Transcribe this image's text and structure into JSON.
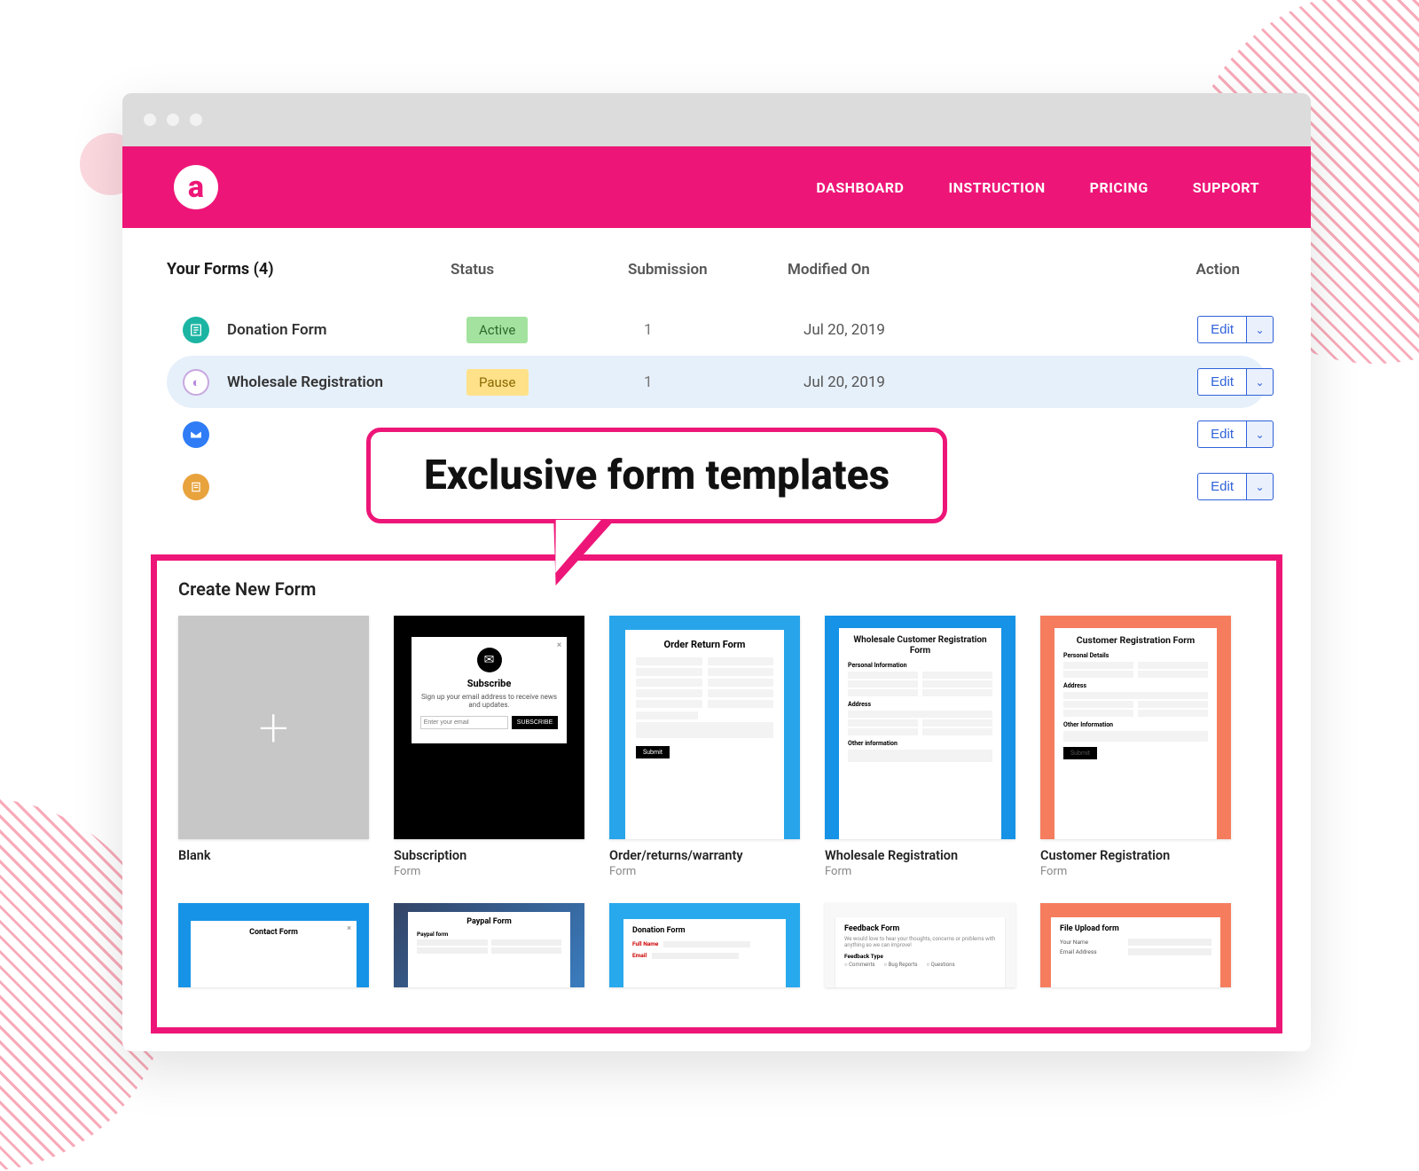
{
  "logo_letter": "a",
  "nav": [
    "DASHBOARD",
    "INSTRUCTION",
    "PRICING",
    "SUPPORT"
  ],
  "table": {
    "title": "Your Forms (4)",
    "columns": [
      "Status",
      "Submission",
      "Modified On",
      "Action"
    ],
    "edit_label": "Edit",
    "rows": [
      {
        "name": "Donation Form",
        "status": "Active",
        "status_class": "status-active",
        "submission": "1",
        "modified": "Jul 20, 2019",
        "icon": "ic-teal",
        "highlight": false
      },
      {
        "name": "Wholesale Registration",
        "status": "Pause",
        "status_class": "status-pause",
        "submission": "1",
        "modified": "Jul 20, 2019",
        "icon": "ic-lav",
        "highlight": true
      },
      {
        "name": "",
        "status": "",
        "status_class": "",
        "submission": "",
        "modified": "",
        "icon": "ic-blue",
        "highlight": false
      },
      {
        "name": "",
        "status": "",
        "status_class": "",
        "submission": "",
        "modified": "",
        "icon": "ic-amber",
        "highlight": false
      }
    ]
  },
  "callout": "Exclusive form templates",
  "templates": {
    "heading": "Create New Form",
    "row1": [
      {
        "title": "Blank",
        "sub": ""
      },
      {
        "title": "Subscription",
        "sub": "Form"
      },
      {
        "title": "Order/returns/warranty",
        "sub": "Form"
      },
      {
        "title": "Wholesale Registration",
        "sub": "Form"
      },
      {
        "title": "Customer Registration",
        "sub": "Form"
      }
    ],
    "thumbs": {
      "subscribe": {
        "title": "Subscribe",
        "desc": "Sign up your email address to receive news and updates.",
        "placeholder": "Enter your email",
        "btn": "SUBSCRIBE"
      },
      "order": {
        "title": "Order Return Form",
        "btn": "Submit"
      },
      "wholesale": {
        "title": "Wholesale Customer Registration Form",
        "sec1": "Personal Information",
        "sec2": "Address",
        "sec3": "Other information"
      },
      "customer": {
        "title": "Customer Registration Form",
        "sec1": "Personal Details",
        "sec2": "Address",
        "sec3": "Other Information",
        "btn": "Submit"
      },
      "contact": {
        "title": "Contact Form"
      },
      "paypal": {
        "title": "Paypal Form",
        "sec": "Paypal form"
      },
      "donation": {
        "title": "Donation Form",
        "l1": "Full Name",
        "l2": "Email"
      },
      "feedback": {
        "title": "Feedback Form",
        "desc": "We would love to hear your thoughts, concerns or problems with anything so we can improve!",
        "sec": "Feedback Type",
        "o1": "Comments",
        "o2": "Bug Reports",
        "o3": "Questions"
      },
      "fileupload": {
        "title": "File Upload form",
        "l1": "Your Name",
        "l2": "Email Address"
      }
    }
  }
}
